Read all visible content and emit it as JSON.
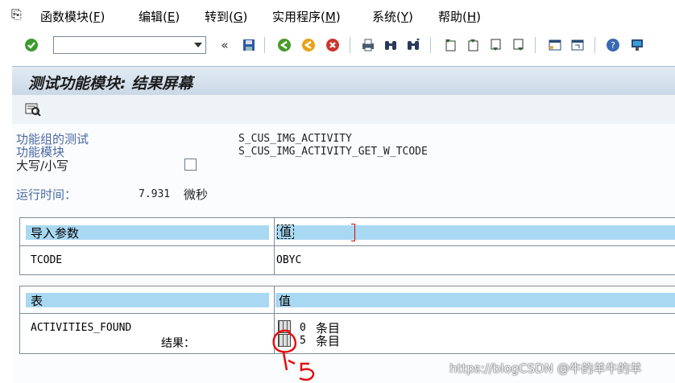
{
  "menu": {
    "items": [
      {
        "label": "函数模块",
        "key": "F"
      },
      {
        "label": "编辑",
        "key": "E"
      },
      {
        "label": "转到",
        "key": "G"
      },
      {
        "label": "实用程序",
        "key": "M"
      },
      {
        "label": "系统",
        "key": "Y"
      },
      {
        "label": "帮助",
        "key": "H"
      }
    ]
  },
  "toolbar": {
    "command_value": ""
  },
  "title": "测试功能模块: 结果屏幕",
  "info": {
    "group_label": "功能组的测试",
    "group_value": "S_CUS_IMG_ACTIVITY",
    "module_label": "功能模块",
    "module_value": "S_CUS_IMG_ACTIVITY_GET_W_TCODE",
    "case_label": "大写/小写",
    "runtime_label": "运行时间：",
    "runtime_value": "7.931",
    "runtime_unit": "微秒"
  },
  "import_table": {
    "col1": "导入参数",
    "col2": "值",
    "rows": [
      {
        "name": "TCODE",
        "value": "OBYC"
      }
    ]
  },
  "tables_table": {
    "col1": "表",
    "col2": "值",
    "row_name": "ACTIVITIES_FOUND",
    "row_count": "0",
    "row_unit": "条目",
    "result_label": "结果：",
    "result_count": "5",
    "result_unit": "条目"
  },
  "watermark": "https://blogCSDN @牛的羊牛的羊"
}
